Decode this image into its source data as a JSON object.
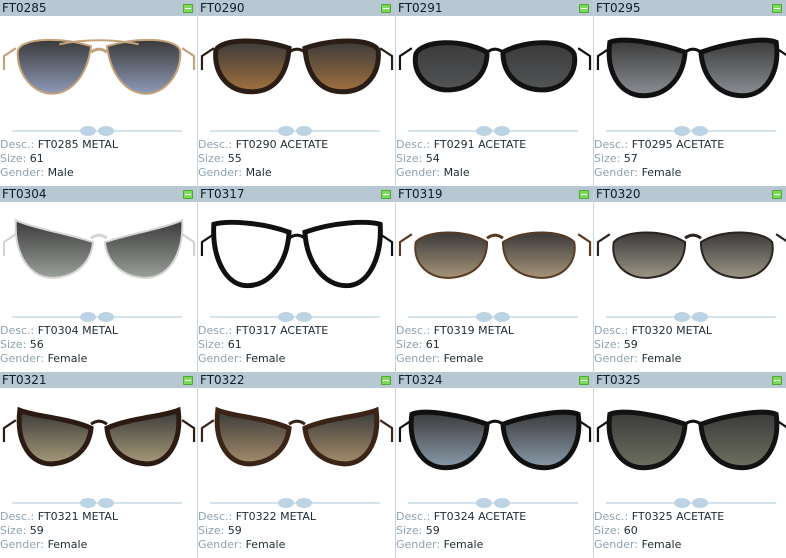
{
  "labels": {
    "desc": "Desc.:",
    "size": "Size:",
    "gender": "Gender:"
  },
  "products": [
    {
      "code": "FT0285",
      "desc": "FT0285 METAL",
      "size": "61",
      "gender": "Male",
      "style": "aviator",
      "frame": "#c4a27a",
      "lens": "#8e9ab8"
    },
    {
      "code": "FT0290",
      "desc": "FT0290 ACETATE",
      "size": "55",
      "gender": "Male",
      "style": "square",
      "frame": "#2a1d16",
      "lens": "#a2713f"
    },
    {
      "code": "FT0291",
      "desc": "FT0291 ACETATE",
      "size": "54",
      "gender": "Male",
      "style": "round",
      "frame": "#121212",
      "lens": "#525456"
    },
    {
      "code": "FT0295",
      "desc": "FT0295 ACETATE",
      "size": "57",
      "gender": "Female",
      "style": "butterfly",
      "frame": "#111111",
      "lens": "#8b8f94"
    },
    {
      "code": "FT0304",
      "desc": "FT0304 METAL",
      "size": "56",
      "gender": "Female",
      "style": "cateye",
      "frame": "#d4d4d4",
      "lens": "#9aa09a"
    },
    {
      "code": "FT0317",
      "desc": "FT0317 ACETATE",
      "size": "61",
      "gender": "Female",
      "style": "optical",
      "frame": "#101010",
      "lens": "#ffffff"
    },
    {
      "code": "FT0319",
      "desc": "FT0319 METAL",
      "size": "61",
      "gender": "Female",
      "style": "roundthin",
      "frame": "#5a3a22",
      "lens": "#a69479"
    },
    {
      "code": "FT0320",
      "desc": "FT0320 METAL",
      "size": "59",
      "gender": "Female",
      "style": "roundthin",
      "frame": "#2a2320",
      "lens": "#9a9684"
    },
    {
      "code": "FT0321",
      "desc": "FT0321 METAL",
      "size": "59",
      "gender": "Female",
      "style": "cateye2",
      "frame": "#2b1b12",
      "lens": "#a69a78"
    },
    {
      "code": "FT0322",
      "desc": "FT0322 METAL",
      "size": "59",
      "gender": "Female",
      "style": "cateye2",
      "frame": "#3a2418",
      "lens": "#a58c6a"
    },
    {
      "code": "FT0324",
      "desc": "FT0324 ACETATE",
      "size": "59",
      "gender": "Female",
      "style": "butterfly2",
      "frame": "#101010",
      "lens": "#8a9bab"
    },
    {
      "code": "FT0325",
      "desc": "FT0325 ACETATE",
      "size": "60",
      "gender": "Female",
      "style": "butterfly2",
      "frame": "#121212",
      "lens": "#6e7060"
    }
  ]
}
